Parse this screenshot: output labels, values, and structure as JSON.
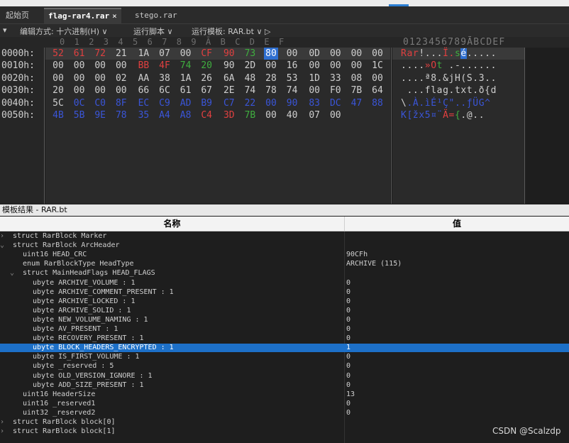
{
  "tabs": [
    {
      "label": "起始页",
      "active": false
    },
    {
      "label": "flag-rar4.rar",
      "active": true
    },
    {
      "label": "stego.rar",
      "active": false
    }
  ],
  "tab_close": "×",
  "toolbar": {
    "menu_glyph": "▾",
    "edit_mode": "编辑方式: 十六进制(H) ∨",
    "run_script": "运行脚本 ∨",
    "run_template": "运行模板: RAR.bt ∨  ▷"
  },
  "hex_columns": [
    "0",
    "1",
    "2",
    "3",
    "4",
    "5",
    "6",
    "7",
    "8",
    "9",
    "Ā",
    "B",
    "C",
    "D",
    "E",
    "F"
  ],
  "ascii_header": "0123456789ĀBCDEF",
  "rows": [
    {
      "offset": "0000h:",
      "bytes": [
        "52",
        "61",
        "72",
        "21",
        "1A",
        "07",
        "00",
        "CF",
        "90",
        "73",
        "80",
        "00",
        "0D",
        "00",
        "00",
        "00"
      ],
      "ascii": "Rar!...Ï.sé.....",
      "highlight": true
    },
    {
      "offset": "0010h:",
      "bytes": [
        "00",
        "00",
        "00",
        "00",
        "BB",
        "4F",
        "74",
        "20",
        "90",
        "2D",
        "00",
        "16",
        "00",
        "00",
        "00",
        "1C"
      ],
      "ascii": "....»Ot .-......",
      "highlight": false
    },
    {
      "offset": "0020h:",
      "bytes": [
        "00",
        "00",
        "00",
        "02",
        "AA",
        "38",
        "1A",
        "26",
        "6A",
        "48",
        "28",
        "53",
        "1D",
        "33",
        "08",
        "00"
      ],
      "ascii": "....ª8.&jH(S.3..",
      "highlight": false
    },
    {
      "offset": "0030h:",
      "bytes": [
        "20",
        "00",
        "00",
        "00",
        "66",
        "6C",
        "61",
        "67",
        "2E",
        "74",
        "78",
        "74",
        "00",
        "F0",
        "7B",
        "64"
      ],
      "ascii": " ...flag.txt.ð{d",
      "highlight": false
    },
    {
      "offset": "0040h:",
      "bytes": [
        "5C",
        "0C",
        "C0",
        "8F",
        "EC",
        "C9",
        "AD",
        "B9",
        "C7",
        "22",
        "00",
        "90",
        "83",
        "DC",
        "47",
        "88"
      ],
      "ascii": "\\.À.ìÉ­¹Ç\"..ƒÜG^",
      "highlight": false
    },
    {
      "offset": "0050h:",
      "bytes": [
        "4B",
        "5B",
        "9E",
        "78",
        "35",
        "A4",
        "A8",
        "C4",
        "3D",
        "7B",
        "00",
        "40",
        "07",
        "00"
      ],
      "ascii": "K[žx5¤¨Ä={.@..",
      "highlight": false
    }
  ],
  "colors": {
    "red": "#e04040",
    "green": "#3fae3f",
    "blue": "#3a55d8",
    "white": "#cfcfcf",
    "cursor": "#2f6fd0",
    "selection": "#1d70c8"
  },
  "byte_colors": [
    [
      "red",
      "red",
      "red",
      "white",
      "white",
      "white",
      "white",
      "red",
      "red",
      "green",
      "cursor",
      "white",
      "white",
      "white",
      "white",
      "white"
    ],
    [
      "white",
      "white",
      "white",
      "white",
      "red",
      "red",
      "green",
      "green",
      "white",
      "white",
      "white",
      "white",
      "white",
      "white",
      "white",
      "white"
    ],
    [
      "white",
      "white",
      "white",
      "white",
      "white",
      "white",
      "white",
      "white",
      "white",
      "white",
      "white",
      "white",
      "white",
      "white",
      "white",
      "white"
    ],
    [
      "white",
      "white",
      "white",
      "white",
      "white",
      "white",
      "white",
      "white",
      "white",
      "white",
      "white",
      "white",
      "white",
      "white",
      "white",
      "white"
    ],
    [
      "white",
      "blue",
      "blue",
      "blue",
      "blue",
      "blue",
      "blue",
      "blue",
      "blue",
      "blue",
      "blue",
      "blue",
      "blue",
      "blue",
      "blue",
      "blue"
    ],
    [
      "blue",
      "blue",
      "blue",
      "blue",
      "blue",
      "blue",
      "blue",
      "red",
      "red",
      "green",
      "white",
      "white",
      "white",
      "white"
    ]
  ],
  "template_panel": {
    "title": "模板结果 - RAR.bt",
    "col_name": "名称",
    "col_value": "值"
  },
  "tree": [
    {
      "toggle": "›",
      "name": "struct RarBlock Marker",
      "value": "",
      "indent": 0
    },
    {
      "toggle": "⌄",
      "name": "struct RarBlock ArcHeader",
      "value": "",
      "indent": 0
    },
    {
      "toggle": "",
      "name": "uint16 HEAD_CRC",
      "value": "90CFh",
      "indent": 2
    },
    {
      "toggle": "",
      "name": "enum RarBlockType HeadType",
      "value": "ARCHIVE (115)",
      "indent": 2
    },
    {
      "toggle": "⌄",
      "name": "struct MainHeadFlags HEAD_FLAGS",
      "value": "",
      "indent": 2
    },
    {
      "toggle": "",
      "name": "ubyte ARCHIVE_VOLUME : 1",
      "value": "0",
      "indent": 4
    },
    {
      "toggle": "",
      "name": "ubyte ARCHIVE_COMMENT_PRESENT : 1",
      "value": "0",
      "indent": 4
    },
    {
      "toggle": "",
      "name": "ubyte ARCHIVE_LOCKED : 1",
      "value": "0",
      "indent": 4
    },
    {
      "toggle": "",
      "name": "ubyte ARCHIVE_SOLID : 1",
      "value": "0",
      "indent": 4
    },
    {
      "toggle": "",
      "name": "ubyte NEW_VOLUME_NAMING : 1",
      "value": "0",
      "indent": 4
    },
    {
      "toggle": "",
      "name": "ubyte AV_PRESENT : 1",
      "value": "0",
      "indent": 4
    },
    {
      "toggle": "",
      "name": "ubyte RECOVERY_PRESENT : 1",
      "value": "0",
      "indent": 4
    },
    {
      "toggle": "",
      "name": "ubyte BLOCK_HEADERS_ENCRYPTED : 1",
      "value": "1",
      "indent": 4,
      "selected": true
    },
    {
      "toggle": "",
      "name": "ubyte IS_FIRST_VOLUME : 1",
      "value": "0",
      "indent": 4
    },
    {
      "toggle": "",
      "name": "ubyte _reserved : 5",
      "value": "0",
      "indent": 4
    },
    {
      "toggle": "",
      "name": "ubyte OLD_VERSION_IGNORE : 1",
      "value": "0",
      "indent": 4
    },
    {
      "toggle": "",
      "name": "ubyte ADD_SIZE_PRESENT : 1",
      "value": "0",
      "indent": 4
    },
    {
      "toggle": "",
      "name": "uint16 HeaderSize",
      "value": "13",
      "indent": 2
    },
    {
      "toggle": "",
      "name": "uint16 _reserved1",
      "value": "0",
      "indent": 2
    },
    {
      "toggle": "",
      "name": "uint32 _reserved2",
      "value": "0",
      "indent": 2
    },
    {
      "toggle": "›",
      "name": "struct RarBlock block[0]",
      "value": "",
      "indent": 0
    },
    {
      "toggle": "›",
      "name": "struct RarBlock block[1]",
      "value": "",
      "indent": 0
    }
  ],
  "watermark": "CSDN @Scalzdp"
}
